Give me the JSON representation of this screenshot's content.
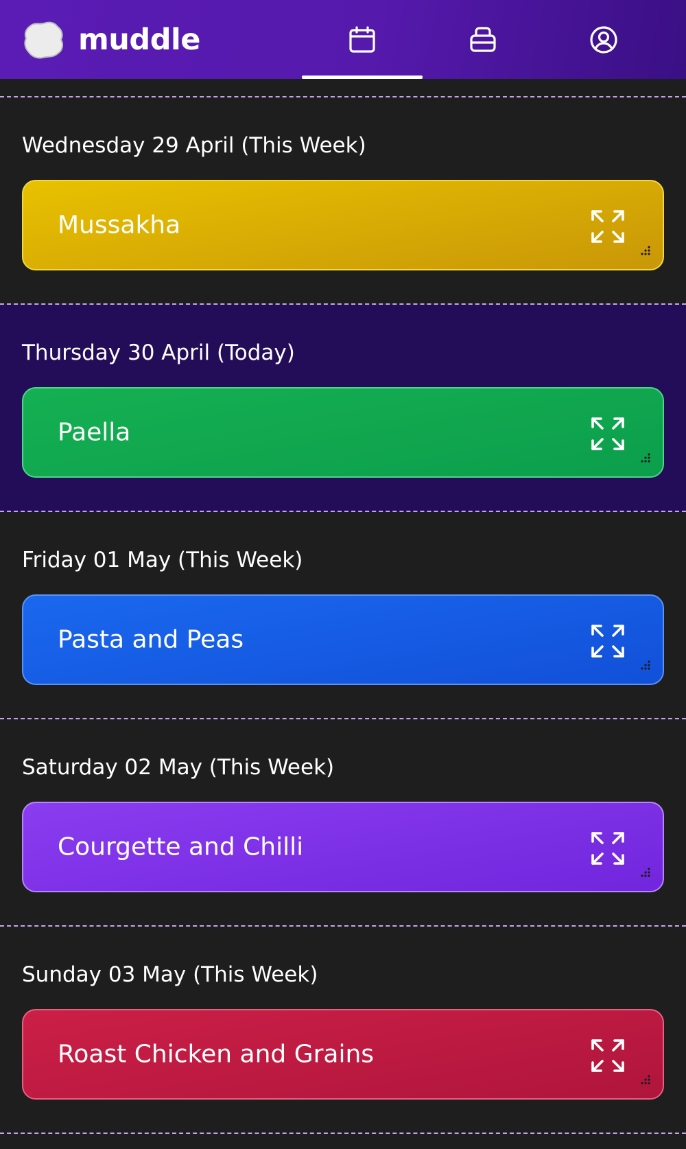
{
  "app": {
    "name": "muddle"
  },
  "nav": {
    "tabs": [
      {
        "icon": "calendar-icon",
        "active": true
      },
      {
        "icon": "pantry-container-icon",
        "active": false
      },
      {
        "icon": "user-account-icon",
        "active": false
      }
    ]
  },
  "days": [
    {
      "label": "Wednesday 29 April (This Week)",
      "meal": "Mussakha",
      "color_top": "#e8c100",
      "color_bottom": "#c99708",
      "border": "#f2d840",
      "today": false
    },
    {
      "label": "Thursday 30 April (Today)",
      "meal": "Paella",
      "color_top": "#15b052",
      "color_bottom": "#0c9e4c",
      "border": "#4fd68a",
      "today": true
    },
    {
      "label": "Friday 01 May (This Week)",
      "meal": "Pasta and Peas",
      "color_top": "#1a68ef",
      "color_bottom": "#1250d8",
      "border": "#5b93f5",
      "today": false
    },
    {
      "label": "Saturday 02 May (This Week)",
      "meal": "Courgette and Chilli",
      "color_top": "#8a3cf0",
      "color_bottom": "#7126dd",
      "border": "#b587f7",
      "today": false
    },
    {
      "label": "Sunday 03 May (This Week)",
      "meal": "Roast Chicken and Grains",
      "color_top": "#cb1f47",
      "color_bottom": "#b0153c",
      "border": "#e8607f",
      "today": false
    }
  ],
  "colors": {
    "header_gradient_start": "#5a1cb5",
    "header_gradient_end": "#3a0f84",
    "background": "#1e1e1e",
    "today_background": "#230d59",
    "divider": "#c9a2ef"
  }
}
